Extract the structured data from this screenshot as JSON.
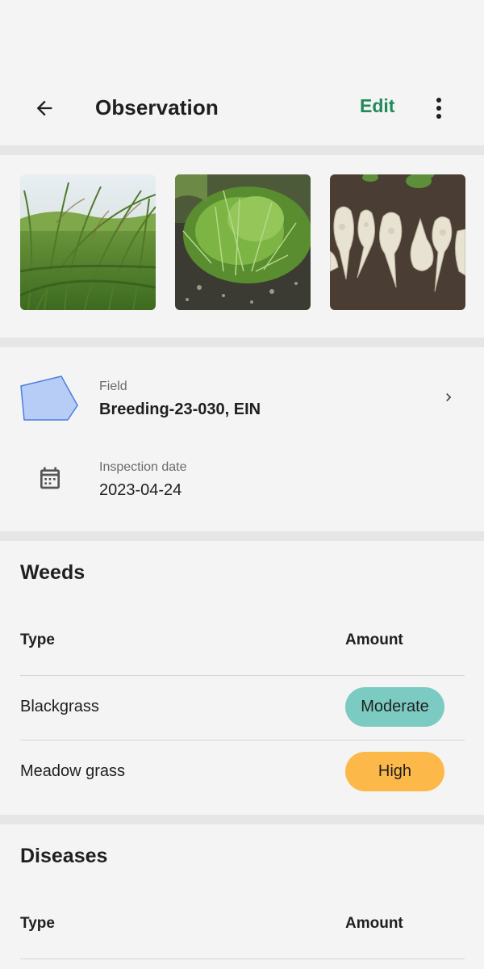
{
  "header": {
    "title": "Observation",
    "edit_label": "Edit"
  },
  "photos": [
    {
      "name": "tall-grass-photo"
    },
    {
      "name": "grass-tuft-photo"
    },
    {
      "name": "sugar-beet-photo"
    }
  ],
  "field": {
    "label": "Field",
    "value": "Breeding-23-030, EIN"
  },
  "inspection": {
    "label": "Inspection date",
    "value": "2023-04-24"
  },
  "weeds": {
    "title": "Weeds",
    "col_type": "Type",
    "col_amount": "Amount",
    "rows": [
      {
        "type": "Blackgrass",
        "amount": "Moderate",
        "color": "#7ccbc2"
      },
      {
        "type": "Meadow grass",
        "amount": "High",
        "color": "#fdb84a"
      }
    ]
  },
  "diseases": {
    "title": "Diseases",
    "col_type": "Type",
    "col_amount": "Amount",
    "next_pill_color": "#7ccbc2"
  },
  "colors": {
    "accent": "#1e8b58",
    "polygon_fill": "#b8cdf5",
    "polygon_stroke": "#4a7fe0",
    "moderate": "#7ccbc2",
    "high": "#fdb84a"
  }
}
